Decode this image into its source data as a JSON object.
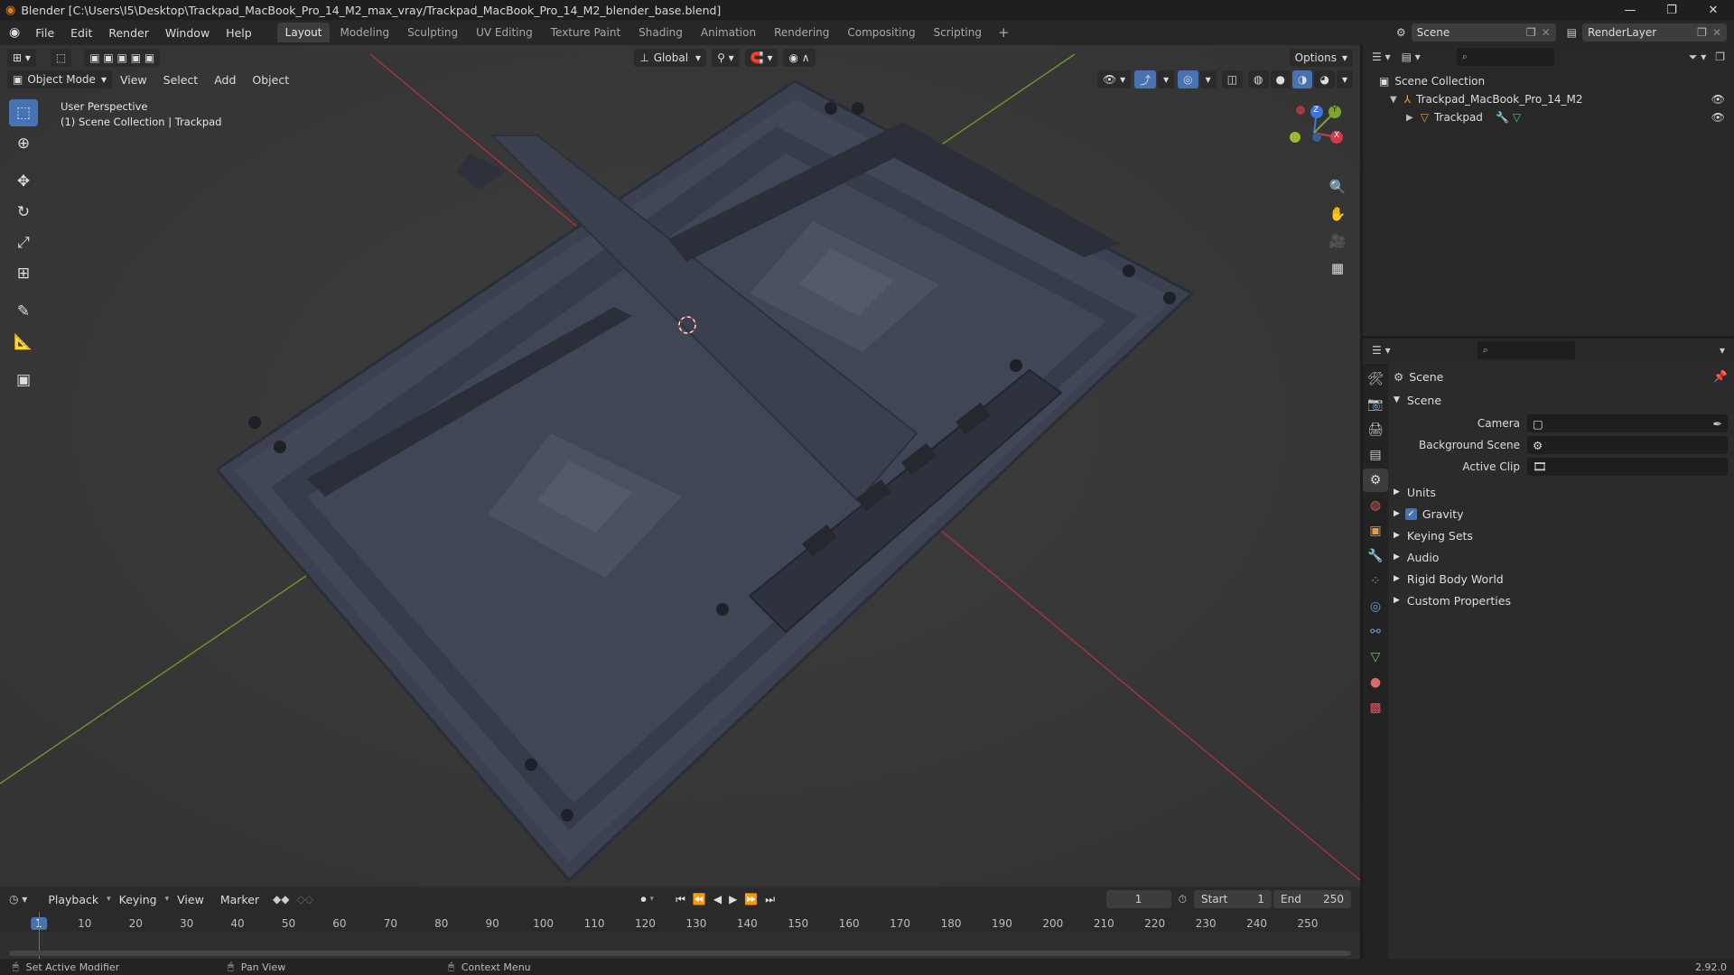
{
  "window": {
    "title": "Blender [C:\\Users\\I5\\Desktop\\Trackpad_MacBook_Pro_14_M2_max_vray/Trackpad_MacBook_Pro_14_M2_blender_base.blend]"
  },
  "menubar": {
    "menus": [
      "File",
      "Edit",
      "Render",
      "Window",
      "Help"
    ],
    "workspaces": [
      "Layout",
      "Modeling",
      "Sculpting",
      "UV Editing",
      "Texture Paint",
      "Shading",
      "Animation",
      "Rendering",
      "Compositing",
      "Scripting"
    ],
    "active_workspace": "Layout",
    "scene_name": "Scene",
    "render_layer": "RenderLayer"
  },
  "viewport": {
    "mode": "Object Mode",
    "menus": [
      "View",
      "Select",
      "Add",
      "Object"
    ],
    "orientation": "Global",
    "options_label": "Options",
    "overlay_line1": "User Perspective",
    "overlay_line2": "(1) Scene Collection | Trackpad",
    "gizmo": {
      "z": "Z",
      "y": "Y",
      "x": "X"
    }
  },
  "outliner": {
    "root": "Scene Collection",
    "collection": "Trackpad_MacBook_Pro_14_M2",
    "object": "Trackpad"
  },
  "properties": {
    "context": "Scene",
    "panel_title": "Scene",
    "camera_label": "Camera",
    "background_scene_label": "Background Scene",
    "active_clip_label": "Active Clip",
    "sections": [
      "Units",
      "Gravity",
      "Keying Sets",
      "Audio",
      "Rigid Body World",
      "Custom Properties"
    ],
    "gravity_checked": true
  },
  "timeline": {
    "menus": [
      "Playback",
      "Keying",
      "View",
      "Marker"
    ],
    "current_frame": "1",
    "start_label": "Start",
    "start_value": "1",
    "end_label": "End",
    "end_value": "250",
    "ruler": [
      "1",
      "10",
      "20",
      "30",
      "40",
      "50",
      "60",
      "70",
      "80",
      "90",
      "100",
      "110",
      "120",
      "130",
      "140",
      "150",
      "160",
      "170",
      "180",
      "190",
      "200",
      "210",
      "220",
      "230",
      "240",
      "250"
    ]
  },
  "statusbar": {
    "left": "Set Active Modifier",
    "middle": "Pan View",
    "right": "Context Menu",
    "version": "2.92.0"
  },
  "colors": {
    "accent": "#4772b3",
    "viewport_bg": "#393939",
    "x_axis": "#a8343f",
    "y_axis": "#6a9a2a",
    "model": "#3d4352"
  }
}
